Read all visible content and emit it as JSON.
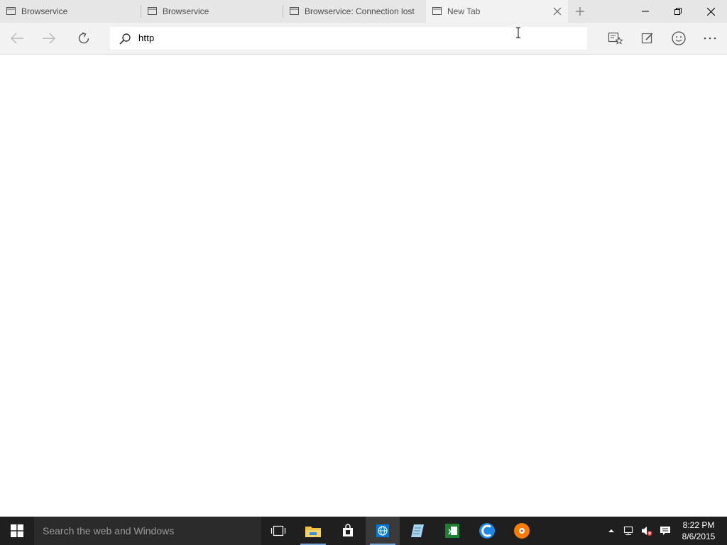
{
  "tabs": [
    {
      "label": "Browservice",
      "active": false
    },
    {
      "label": "Browservice",
      "active": false
    },
    {
      "label": "Browservice: Connection lost",
      "active": false
    },
    {
      "label": "New Tab",
      "active": true
    }
  ],
  "address_bar": {
    "value": "http"
  },
  "taskbar": {
    "search_placeholder": "Search the web and Windows",
    "apps": [
      "task-view",
      "file-explorer",
      "store",
      "edge",
      "notepad",
      "excel",
      "browser",
      "media-player"
    ]
  },
  "clock": {
    "time": "8:22 PM",
    "date": "8/6/2015"
  },
  "colors": {
    "tabstrip": "#e6e6e6",
    "toolbar": "#f2f2f2",
    "taskbar": "#1f1f1f",
    "accent": "#0078d7"
  }
}
